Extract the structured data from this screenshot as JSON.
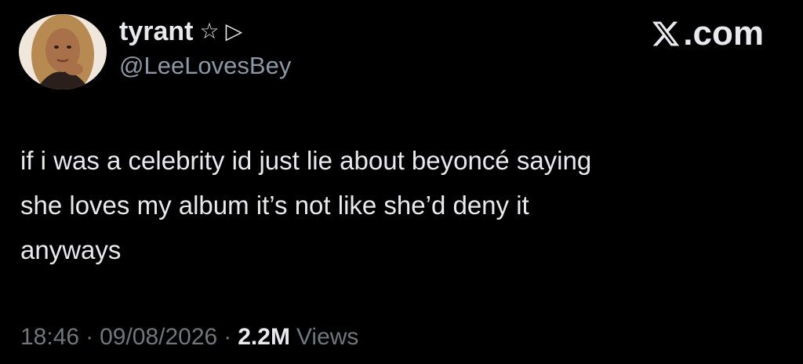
{
  "author": {
    "display_name": "tyrant",
    "name_icons": [
      "☆",
      "▷"
    ],
    "handle": "@LeeLovesBey",
    "avatar": "profile-photo"
  },
  "brand": {
    "logo_text": ".com",
    "logo_icon": "x-logo-icon"
  },
  "tweet": {
    "text": "if i was a celebrity id just lie about beyoncé saying\nshe loves my album it’s not like she’d deny it\nanyways"
  },
  "meta": {
    "time": "18:46",
    "separator": "·",
    "date": "09/08/2026",
    "views_count": "2.2M",
    "views_label": "Views"
  },
  "colors": {
    "background": "#000000",
    "primary_text": "#e7e9ea",
    "secondary_text": "#71767b"
  }
}
